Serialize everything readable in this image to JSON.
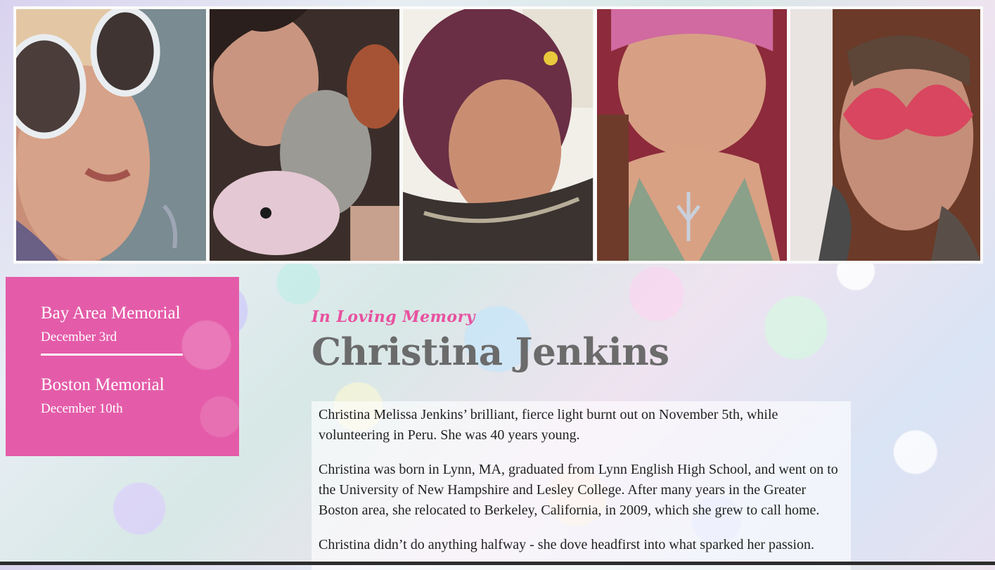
{
  "gallery": {
    "photos": [
      {
        "icon": "portrait-sunglasses-photo"
      },
      {
        "icon": "portrait-plush-toys-photo"
      },
      {
        "icon": "portrait-purple-hair-photo"
      },
      {
        "icon": "portrait-pink-hair-photo"
      },
      {
        "icon": "portrait-lace-mask-photo"
      }
    ]
  },
  "sidebar": {
    "events": [
      {
        "title": "Bay Area Memorial",
        "date": "December 3rd"
      },
      {
        "title": "Boston Memorial",
        "date": "December 10th"
      }
    ]
  },
  "main": {
    "kicker": "In Loving Memory",
    "name": "Christina Jenkins",
    "paragraphs": [
      "Christina Melissa Jenkins’ brilliant, fierce light burnt out on November 5th, while volunteering in Peru. She was 40 years young.",
      "Christina was born in Lynn, MA, graduated from Lynn English High School, and went on to the University of New Hampshire and Lesley College. After many years in the Greater Boston area, she relocated to Berkeley, California, in 2009, which she grew to call home.",
      "Christina didn’t do anything halfway - she dove headfirst into what sparked her passion."
    ]
  },
  "colors": {
    "accent": "#e45ca9",
    "kicker": "#e8519f",
    "name": "#6b6b6b"
  }
}
